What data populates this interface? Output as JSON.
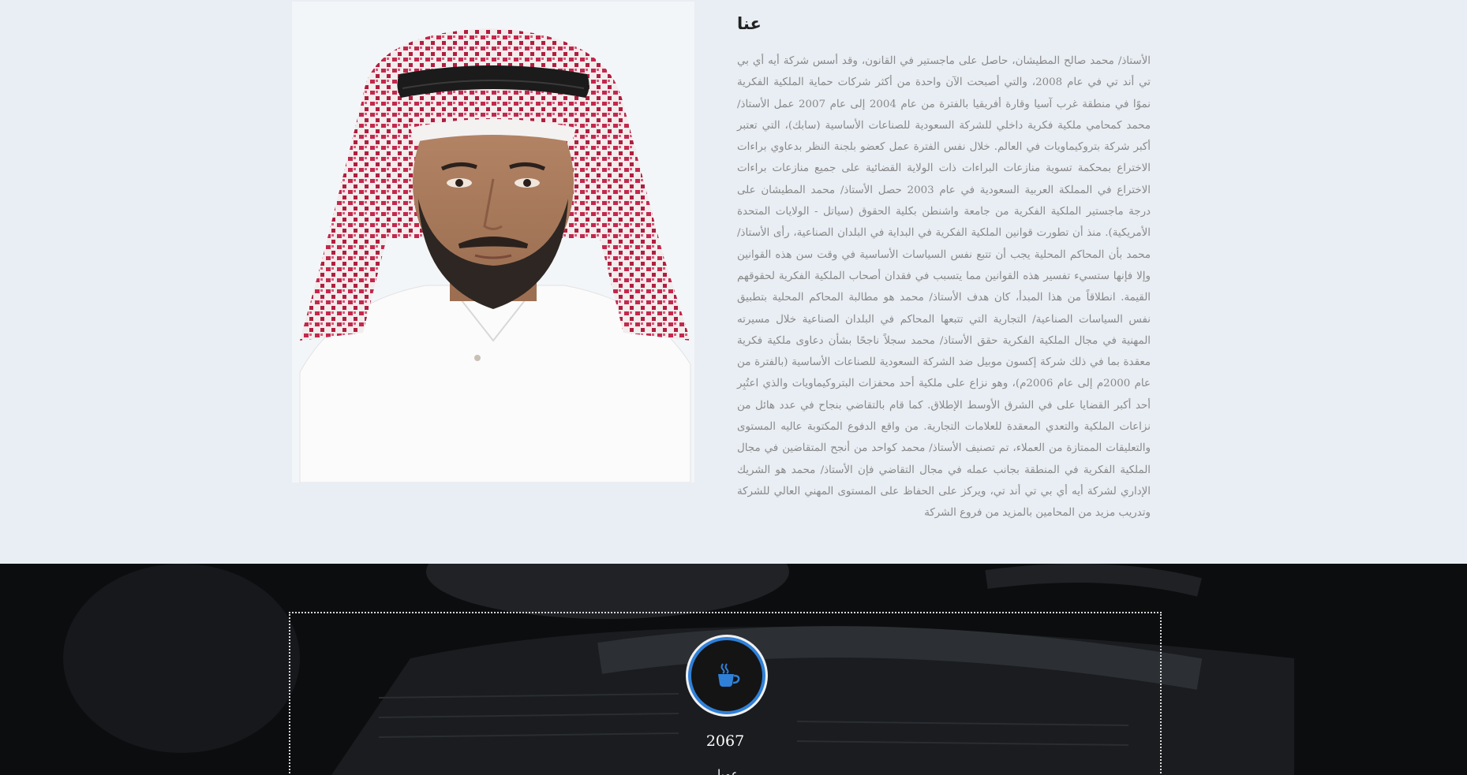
{
  "about": {
    "title": "عنا",
    "body": "الأستاذ/ محمد صالح المطيشان، حاصل على ماجستير في القانون، وقد أسس شركة أيه أي بي تي أند تي في عام 2008، والتي أصبحت الآن واحدة من أكثر شركات حماية الملكية الفكرية نموًا في منطقة غرب آسيا وقارة أفريقيا بالفترة من عام 2004 إلى عام 2007 عمل الأستاذ/ محمد كمحامي ملكية فكرية داخلي للشركة السعودية للصناعات الأساسية (سابك)، التي تعتبر أكبر شركة بتروكيماويات في العالم. خلال نفس الفترة عمل كعضو بلجنة النظر بدعاوي براءات الاختراع بمحكمة تسوية منازعات البراءات ذات الولاية القضائية على جميع منازعات براءات الاختراع في المملكة العربية السعودية في عام 2003 حصل الأستاذ/ محمد المطيشان على درجة ماجستير الملكية الفكرية من جامعة واشنطن بكلية الحقوق (سياتل - الولايات المتحدة الأمريكية). منذ أن تطورت قوانين الملكية الفكرية في البداية في البلدان الصناعية، رأى الأستاذ/ محمد بأن المحاكم المحلية يجب أن تتبع نفس السياسات الأساسية في وقت سن هذه القوانين وإلا فإنها ستسيء تفسير هذه القوانين مما يتسبب في فقدان أصحاب الملكية الفكرية لحقوقهم القيمة. انطلاقاً من هذا المبدأ، كان هدف الأستاذ/ محمد هو مطالبة المحاكم المحلية بتطبيق نفس السياسات الصناعية/ التجارية التي تتبعها المحاكم في البلدان الصناعية خلال مسيرته المهنية في مجال الملكية الفكرية حقق الأستاذ/ محمد سجلاً ناجحًا بشأن دعاوى ملكية فكرية معقدة بما في ذلك شركة إكسون موبيل ضد الشركة السعودية للصناعات الأساسية (بالفترة من عام 2000م إلى عام 2006م)، وهو نزاع على ملكية أحد محفزات البتروكيماويات والذي اعتُبِر أحد أكبر القضايا على في الشرق الأوسط الإطلاق. كما قام بالتقاضي بنجاح في عدد هائل من نزاعات الملكية والتعدي المعقدة للعلامات التجارية. من واقع الدفوع المكتوبة عاليه المستوى والتعليقات الممتازة من العملاء، تم تصنيف الأستاذ/ محمد كواحد من أنجح المتقاضين في مجال الملكية الفكرية في المنطقة بجانب عمله في مجال التقاضي فإن الأستاذ/ محمد هو الشريك الإداري لشركة أيه أي بي تي أند تي، ويركز على الحفاظ على المستوى المهني العالي للشركة وتدريب مزيد من المحامين بالمزيد من فروع الشركة"
  },
  "stats": {
    "icon": "coffee-cup-icon",
    "accent_color": "#2f80d8",
    "value": "2067",
    "label": "عميل"
  }
}
